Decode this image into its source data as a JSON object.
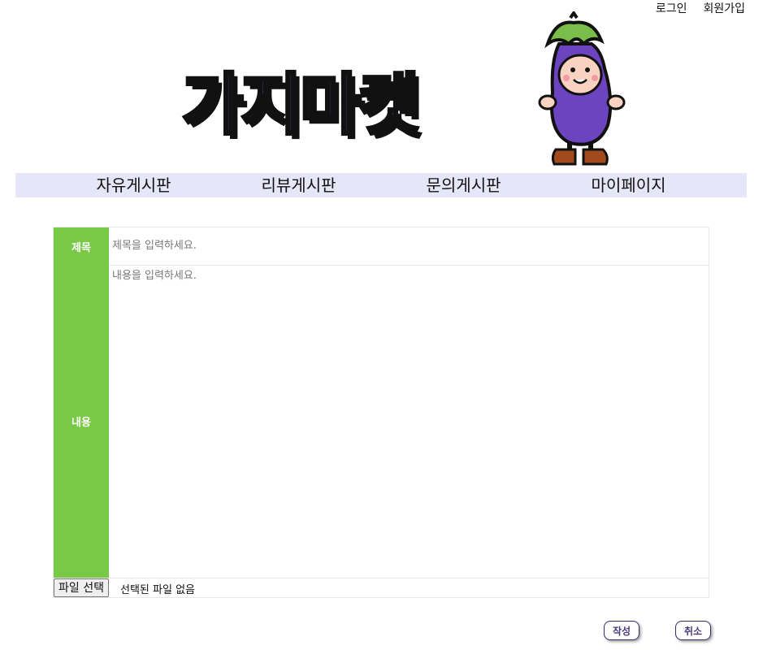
{
  "header": {
    "login_label": "로그인",
    "signup_label": "회원가입",
    "logo_text": "가지마켓"
  },
  "nav": {
    "items": [
      {
        "label": "자유게시판"
      },
      {
        "label": "리뷰게시판"
      },
      {
        "label": "문의게시판"
      },
      {
        "label": "마이페이지"
      }
    ]
  },
  "form": {
    "title_label": "제목",
    "title_placeholder": "제목을 입력하세요.",
    "content_label": "내용",
    "content_placeholder": "내용을 입력하세요.",
    "file_button_label": "파일 선택",
    "file_status": "선택된 파일 없음"
  },
  "actions": {
    "submit_label": "작성",
    "cancel_label": "취소"
  },
  "colors": {
    "accent_green": "#78c945",
    "nav_bg": "#e6e6f8",
    "logo_purple": "#6d44c0"
  }
}
